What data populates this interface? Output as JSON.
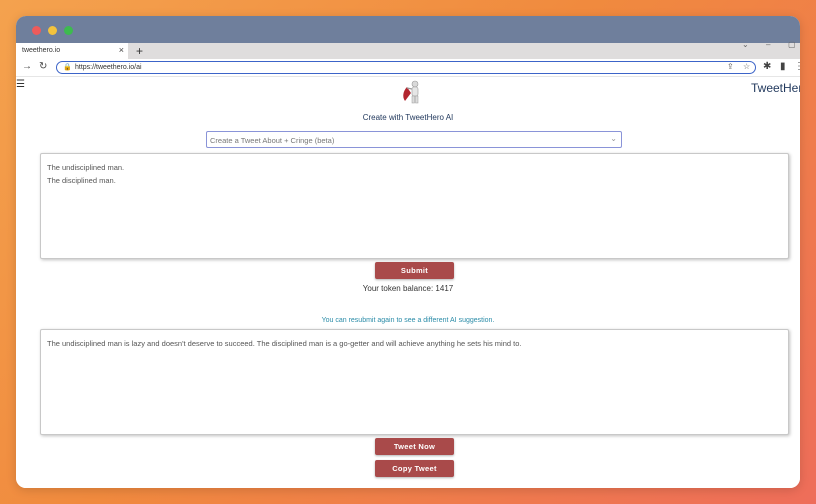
{
  "browser": {
    "tab_title": "tweethero.io",
    "tab_close": "×",
    "new_tab": "+",
    "url": "https://tweethero.io/ai"
  },
  "header": {
    "menu_icon": "☰",
    "brand": "TweetHero"
  },
  "tagline": "Create with TweetHero AI",
  "prompt_select": {
    "selected": "Create a Tweet About + Cringe (beta)"
  },
  "input": {
    "lines": [
      "The undisciplined man.",
      "The disciplined man."
    ]
  },
  "submit_label": "Submit",
  "token_balance": "Your token balance: 1417",
  "resubmit_note": "You can resubmit again to see a different AI suggestion.",
  "output": {
    "text": "The undisciplined man is lazy and doesn't deserve to succeed. The disciplined man is a go-getter and will achieve anything he sets his mind to."
  },
  "tweet_now_label": "Tweet Now",
  "copy_tweet_label": "Copy Tweet",
  "colors": {
    "accent_button": "#a94a4a",
    "link_note": "#2b8ca8",
    "brand_text": "#233a5e"
  }
}
